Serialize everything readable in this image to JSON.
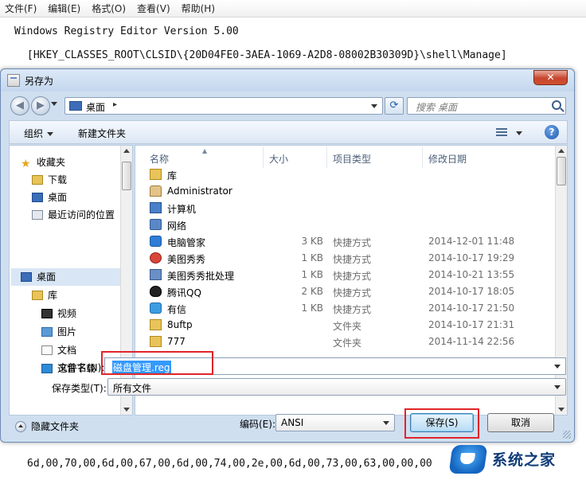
{
  "notepad": {
    "menu": [
      "文件(F)",
      "编辑(E)",
      "格式(O)",
      "查看(V)",
      "帮助(H)"
    ],
    "line1": "Windows Registry Editor Version 5.00",
    "line2": "[HKEY_CLASSES_ROOT\\CLSID\\{20D04FE0-3AEA-1069-A2D8-08002B30309D}\\shell\\Manage]",
    "line_bottom": "6d,00,70,00,6d,00,67,00,6d,00,74,00,2e,00,6d,00,73,00,63,00,00,00"
  },
  "dialog": {
    "title": "另存为",
    "close_label": "✕",
    "address": {
      "location": "桌面",
      "arrow": "▸"
    },
    "search_placeholder": "搜索 桌面",
    "toolbar": {
      "organize": "组织",
      "new_folder": "新建文件夹",
      "help": "?"
    },
    "sidebar": {
      "favorites": "收藏夹",
      "fav_items": [
        "下载",
        "桌面",
        "最近访问的位置"
      ],
      "desktop": "桌面",
      "library": "库",
      "lib_items": [
        "视频",
        "图片",
        "文档",
        "迅雷下载"
      ]
    },
    "columns": {
      "name": "名称",
      "size": "大小",
      "type": "项目类型",
      "date": "修改日期"
    },
    "files": [
      {
        "name": "库",
        "size": "",
        "type": "",
        "date": "",
        "icon": "library-icon"
      },
      {
        "name": "Administrator",
        "size": "",
        "type": "",
        "date": "",
        "icon": "user-folder-icon"
      },
      {
        "name": "计算机",
        "size": "",
        "type": "",
        "date": "",
        "icon": "computer-icon"
      },
      {
        "name": "网络",
        "size": "",
        "type": "",
        "date": "",
        "icon": "network-icon"
      },
      {
        "name": "电脑管家",
        "size": "3 KB",
        "type": "快捷方式",
        "date": "2014-12-01 11:48",
        "icon": "shortcut-icon"
      },
      {
        "name": "美图秀秀",
        "size": "1 KB",
        "type": "快捷方式",
        "date": "2014-10-17 19:29",
        "icon": "shortcut-icon"
      },
      {
        "name": "美图秀秀批处理",
        "size": "1 KB",
        "type": "快捷方式",
        "date": "2014-10-21 13:55",
        "icon": "shortcut-icon"
      },
      {
        "name": "腾讯QQ",
        "size": "2 KB",
        "type": "快捷方式",
        "date": "2014-10-17 18:05",
        "icon": "qq-icon"
      },
      {
        "name": "有信",
        "size": "1 KB",
        "type": "快捷方式",
        "date": "2014-10-17 21:50",
        "icon": "shortcut-icon"
      },
      {
        "name": "8uftp",
        "size": "",
        "type": "文件夹",
        "date": "2014-10-17 21:31",
        "icon": "folder-icon"
      },
      {
        "name": "777",
        "size": "",
        "type": "文件夹",
        "date": "2014-11-14 22:56",
        "icon": "folder-icon"
      }
    ],
    "filename_label": "文件名(N):",
    "filename_value": "磁盘管理.reg",
    "filetype_label": "保存类型(T):",
    "filetype_value": "所有文件",
    "hide_folders": "隐藏文件夹",
    "encoding_label": "编码(E):",
    "encoding_value": "ANSI",
    "save_button": "保存(S)",
    "cancel_button": "取消"
  },
  "watermark": {
    "text": "系统之家"
  },
  "colors": {
    "highlight": "#e0252a",
    "selection": "#3399ff",
    "dialog_bg": "#cfdff0"
  }
}
